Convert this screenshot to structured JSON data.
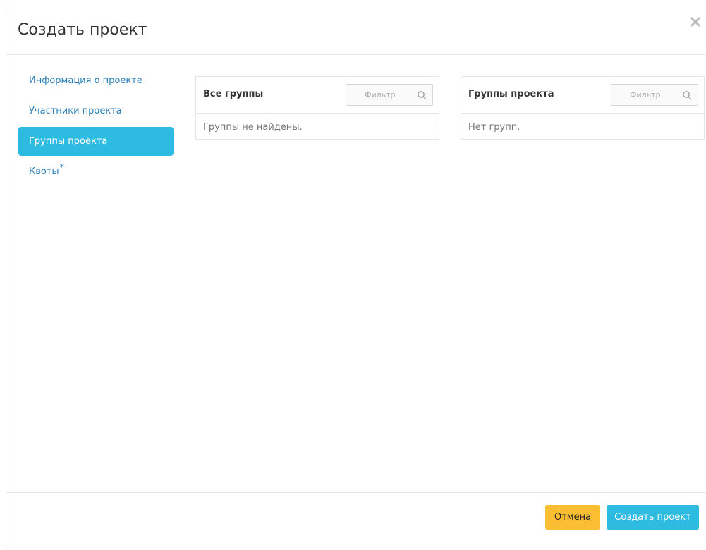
{
  "dialog": {
    "title": "Создать проект",
    "close_icon": "close-icon"
  },
  "nav": {
    "items": [
      {
        "label": "Информация о проекте",
        "active": false
      },
      {
        "label": "Участники проекта",
        "active": false
      },
      {
        "label": "Группы проекта",
        "active": true
      },
      {
        "label": "Квоты",
        "required": true,
        "active": false
      }
    ],
    "required_marker": "*"
  },
  "all_groups": {
    "title": "Все группы",
    "filter_placeholder": "Фильтр",
    "empty_text": "Группы не найдены."
  },
  "project_groups": {
    "title": "Группы проекта",
    "filter_placeholder": "Фильтр",
    "empty_text": "Нет групп."
  },
  "footer": {
    "cancel_label": "Отмена",
    "create_label": "Создать проект"
  },
  "colors": {
    "accent": "#2dbbe1",
    "link": "#2a7fb8",
    "cancel": "#fbbd31"
  }
}
